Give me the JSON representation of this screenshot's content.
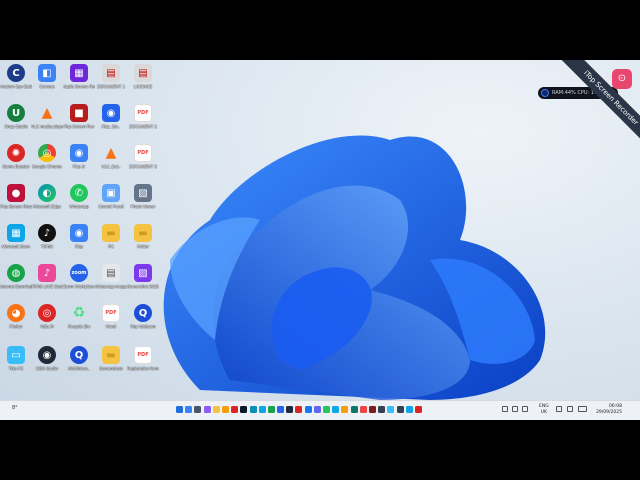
{
  "desktop": {
    "icons": [
      {
        "id": "avatron",
        "label": "Avatron Sys Optimizer",
        "icon": "c-circle-icon",
        "color": "#1e3a8a",
        "glyph": "C"
      },
      {
        "id": "webcam-tool",
        "label": "Camera",
        "icon": "camera-icon",
        "color": "#3b82f6",
        "glyph": "◧"
      },
      {
        "id": "apple-screen",
        "label": "Apple Screen Rec",
        "icon": "grid-icon",
        "color": "#6d28d9",
        "glyph": "▦"
      },
      {
        "id": "doc-1",
        "label": "DOCUMENT 1",
        "icon": "doc-icon",
        "color": "#d9d9d9",
        "glyph": "▤"
      },
      {
        "id": "doc-2",
        "label": "LICENCE",
        "icon": "doc-icon",
        "color": "#d9d9d9",
        "glyph": "▤"
      },
      {
        "id": "u-app",
        "label": "Snap Studio",
        "icon": "u-icon",
        "color": "#15803d",
        "glyph": "U"
      },
      {
        "id": "vlc-1",
        "label": "VLC media player",
        "icon": "vlc-cone-icon",
        "color": "#f97316",
        "glyph": "▲"
      },
      {
        "id": "ispring",
        "label": "iTop Screen Rec",
        "icon": "recorder-icon",
        "color": "#b91c1c",
        "glyph": "■"
      },
      {
        "id": "itop-camera",
        "label": "iTop_Sto..",
        "icon": "webcam-icon",
        "color": "#2563eb",
        "glyph": "◉"
      },
      {
        "id": "pdf-1",
        "label": "DOCUMENT 2",
        "icon": "pdf-icon",
        "color": "#ef4444",
        "glyph": "PDF"
      },
      {
        "id": "red-app",
        "label": "Game Booster",
        "icon": "red-star-icon",
        "color": "#dc2626",
        "glyph": "✺"
      },
      {
        "id": "chrome",
        "label": "Google Chrome",
        "icon": "chrome-icon",
        "color": "#f59e0b",
        "glyph": "◎"
      },
      {
        "id": "itop-2",
        "label": "iTop Jr",
        "icon": "webcam-icon",
        "color": "#3b82f6",
        "glyph": "◉"
      },
      {
        "id": "vlc-2",
        "label": "VLC_Dat..",
        "icon": "vlc-cone-icon",
        "color": "#f97316",
        "glyph": "▲"
      },
      {
        "id": "pdf-2",
        "label": "DOCUMENT 3",
        "icon": "pdf-icon",
        "color": "#ef4444",
        "glyph": "PDF"
      },
      {
        "id": "rec-app",
        "label": "iTop Screen Recorder",
        "icon": "record-icon",
        "color": "#be123c",
        "glyph": "●"
      },
      {
        "id": "edge",
        "label": "Microsoft Edge",
        "icon": "edge-icon",
        "color": "#0891b2",
        "glyph": "◐"
      },
      {
        "id": "whatsapp",
        "label": "WhatsApp",
        "icon": "whatsapp-icon",
        "color": "#22c55e",
        "glyph": "✆"
      },
      {
        "id": "control",
        "label": "Control Panel",
        "icon": "monitor-icon",
        "color": "#60a5fa",
        "glyph": "▣"
      },
      {
        "id": "photo-app",
        "label": "Photo Viewer",
        "icon": "photo-icon",
        "color": "#64748b",
        "glyph": "▨"
      },
      {
        "id": "store",
        "label": "Microsoft Store",
        "icon": "store-icon",
        "color": "#0ea5e9",
        "glyph": "▦"
      },
      {
        "id": "tiktok",
        "label": "TikTok",
        "icon": "tiktok-icon",
        "color": "#111111",
        "glyph": "♪"
      },
      {
        "id": "itop-3",
        "label": "iTop",
        "icon": "webcam-icon",
        "color": "#3b82f6",
        "glyph": "◉"
      },
      {
        "id": "folder-1",
        "label": "PC",
        "icon": "folder-icon",
        "color": "#f5c242",
        "glyph": "▬"
      },
      {
        "id": "folder-2",
        "label": "Folder",
        "icon": "folder-icon",
        "color": "#f5c242",
        "glyph": "▬"
      },
      {
        "id": "network",
        "label": "Internet Downloa..",
        "icon": "globe-icon",
        "color": "#16a34a",
        "glyph": "◍"
      },
      {
        "id": "tiktok-live",
        "label": "TikTok LIVE Studio",
        "icon": "tiktok-live-icon",
        "color": "#ec4899",
        "glyph": "♪"
      },
      {
        "id": "zoom",
        "label": "Zoom Workplace",
        "icon": "zoom-icon",
        "color": "#2563eb",
        "glyph": "zoom"
      },
      {
        "id": "doc-3",
        "label": "WhatsApp Image 2025..",
        "icon": "doc-icon",
        "color": "#e5e7eb",
        "glyph": "▤"
      },
      {
        "id": "img-app",
        "label": "Screenshot 2025..",
        "icon": "image-icon",
        "color": "#7c3aed",
        "glyph": "▨"
      },
      {
        "id": "firefox",
        "label": "Firefox",
        "icon": "firefox-icon",
        "color": "#f97316",
        "glyph": "◕"
      },
      {
        "id": "red-app-2",
        "label": "Yalla.Fr",
        "icon": "target-icon",
        "color": "#dc2626",
        "glyph": "◎"
      },
      {
        "id": "recycle",
        "label": "Recycle Bin",
        "icon": "recycle-icon",
        "color": "#cbd5e1",
        "glyph": "♻"
      },
      {
        "id": "pdf-3",
        "label": "Word",
        "icon": "pdf-icon",
        "color": "#ef4444",
        "glyph": "PDF"
      },
      {
        "id": "q-app",
        "label": "iTop Webcam",
        "icon": "q-icon",
        "color": "#1d4ed8",
        "glyph": "Q"
      },
      {
        "id": "this-pc",
        "label": "This PC",
        "icon": "pc-icon",
        "color": "#38bdf8",
        "glyph": "▭"
      },
      {
        "id": "obs",
        "label": "OBS Studio",
        "icon": "obs-icon",
        "color": "#1f2937",
        "glyph": "◉"
      },
      {
        "id": "q-app-2",
        "label": "MobiMove..",
        "icon": "q-icon",
        "color": "#1d4ed8",
        "glyph": "Q"
      },
      {
        "id": "folder-3",
        "label": "Screenshots",
        "icon": "folder-icon",
        "color": "#f5c242",
        "glyph": "▬"
      },
      {
        "id": "pdf-4",
        "label": "Registration form 1",
        "icon": "pdf-icon",
        "color": "#ef4444",
        "glyph": "PDF"
      }
    ]
  },
  "recorder": {
    "ribbon_text": "iTop Screen Recorder",
    "stats_text": "RAM:44%  CPU: 1%"
  },
  "taskbar": {
    "weather": "8°",
    "apps": [
      {
        "name": "start-icon",
        "color": "#1d6fe0"
      },
      {
        "name": "search-icon",
        "color": "#3b82f6"
      },
      {
        "name": "task-view-icon",
        "color": "#475569"
      },
      {
        "name": "copilot-icon",
        "color": "#8b5cf6"
      },
      {
        "name": "file-explorer-icon",
        "color": "#f5c242"
      },
      {
        "name": "chrome-icon",
        "color": "#f59e0b"
      },
      {
        "name": "recorder-icon",
        "color": "#dc2626"
      },
      {
        "name": "app-icon",
        "color": "#0f172a"
      },
      {
        "name": "edge-icon",
        "color": "#0891b2"
      },
      {
        "name": "store-icon",
        "color": "#0ea5e9"
      },
      {
        "name": "excel-icon",
        "color": "#16a34a"
      },
      {
        "name": "word-icon",
        "color": "#2563eb"
      },
      {
        "name": "app2-icon",
        "color": "#1e293b"
      },
      {
        "name": "app3-icon",
        "color": "#dc2626"
      },
      {
        "name": "facebook-icon",
        "color": "#1877f2"
      },
      {
        "name": "teams-icon",
        "color": "#6366f1"
      },
      {
        "name": "whatsapp-icon",
        "color": "#22c55e"
      },
      {
        "name": "telegram-icon",
        "color": "#0ea5e9"
      },
      {
        "name": "chrome2-icon",
        "color": "#f59e0b"
      },
      {
        "name": "app4-icon",
        "color": "#0f766e"
      },
      {
        "name": "youtube-icon",
        "color": "#ef4444"
      },
      {
        "name": "app5-icon",
        "color": "#7f1d1d"
      },
      {
        "name": "app6-icon",
        "color": "#374151"
      },
      {
        "name": "photos-icon",
        "color": "#38bdf8"
      },
      {
        "name": "app7-icon",
        "color": "#334155"
      },
      {
        "name": "app8-icon",
        "color": "#0ea5e9"
      },
      {
        "name": "app9-icon",
        "color": "#dc2626"
      }
    ],
    "language": "ENG",
    "region": "UK",
    "time": "06:08",
    "date": "29/09/2025"
  }
}
